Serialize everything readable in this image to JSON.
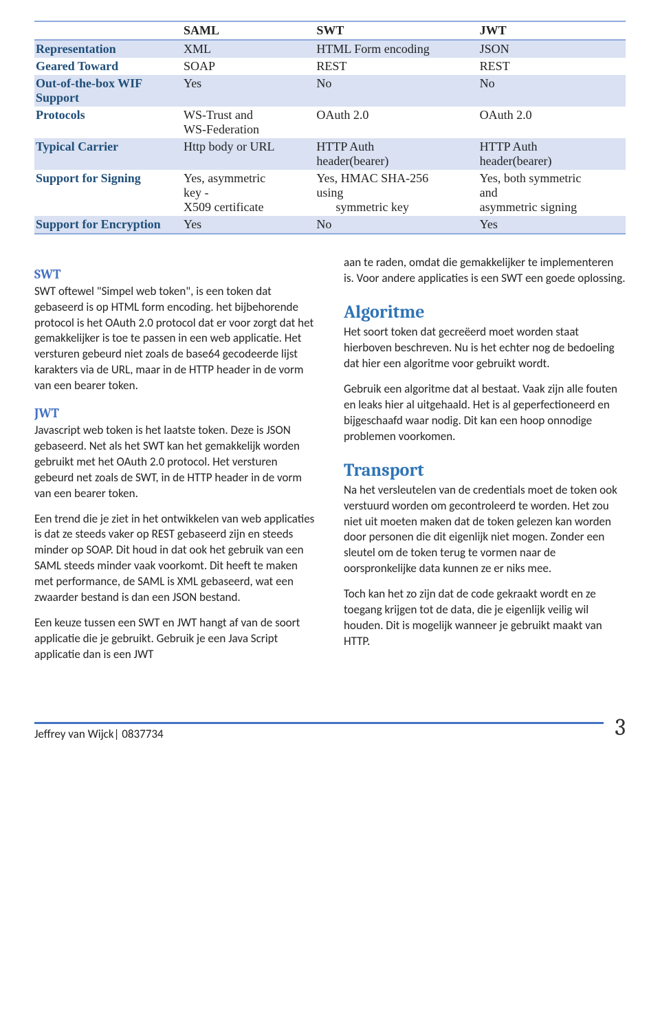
{
  "table": {
    "headers": [
      "",
      "SAML",
      "SWT",
      "JWT"
    ],
    "rows": [
      {
        "band": true,
        "label": "Representation",
        "saml": "XML",
        "swt": "HTML Form encoding",
        "jwt": "JSON"
      },
      {
        "band": false,
        "label": "Geared Toward",
        "saml": "SOAP",
        "swt": "REST",
        "jwt": "REST"
      },
      {
        "band": true,
        "label": "Out-of-the-box WIF\nSupport",
        "saml": "Yes",
        "swt": "No",
        "jwt": "No"
      },
      {
        "band": false,
        "label": "Protocols",
        "saml": "WS-Trust and\nWS-Federation",
        "swt": "OAuth 2.0",
        "jwt": "OAuth 2.0"
      },
      {
        "band": true,
        "label": "Typical Carrier",
        "saml": "Http body or URL",
        "swt": "HTTP Auth\nheader(bearer)",
        "jwt": "HTTP Auth\nheader(bearer)"
      },
      {
        "band": false,
        "label": "Support for Signing",
        "saml": "Yes, asymmetric\nkey -\nX509 certificate",
        "swt": "Yes, HMAC SHA-256\nusing",
        "swt_indent": "symmetric key",
        "jwt": "Yes, both symmetric\nand\nasymmetric signing"
      },
      {
        "band": true,
        "label": "Support for Encryption",
        "saml": "Yes",
        "swt": "No",
        "jwt": "Yes"
      }
    ]
  },
  "left": {
    "swt_heading": "SWT",
    "swt_para": "SWT oftewel \"Simpel web token\", is een token dat gebaseerd is op HTML form encoding. het bijbehorende protocol is het OAuth 2.0 protocol dat er voor zorgt dat het gemakkelijker is toe te passen in een web applicatie. Het versturen gebeurd niet zoals de base64 gecodeerde lijst karakters via de URL, maar in de HTTP header in de vorm van een bearer token.",
    "jwt_heading": "JWT",
    "jwt_para": "Javascript web token is het laatste token. Deze is JSON gebaseerd. Net als het SWT kan het gemakkelijk worden gebruikt met het OAuth 2.0 protocol. Het versturen gebeurd net zoals de SWT, in de HTTP header in de vorm van een bearer token.",
    "trend_para": "Een trend die je ziet in het ontwikkelen van web applicaties is dat ze steeds vaker op REST gebaseerd zijn en steeds minder op SOAP. Dit houd in dat ook het gebruik van een SAML steeds minder vaak voorkomt. Dit heeft te maken met performance, de SAML is XML gebaseerd, wat een zwaarder bestand is dan een JSON bestand.",
    "keuze_para": "Een keuze tussen een SWT en JWT hangt af van de soort applicatie die je gebruikt. Gebruik je een Java Script applicatie dan is een JWT"
  },
  "right": {
    "cont_para": "aan te raden, omdat die gemakkelijker te implementeren is. Voor andere applicaties is een SWT een goede oplossing.",
    "algoritme_heading": "Algoritme",
    "algoritme_para1": "Het soort token dat gecreëerd moet worden staat hierboven beschreven. Nu is het echter nog de bedoeling dat hier een algoritme voor gebruikt wordt.",
    "algoritme_para2": "Gebruik een algoritme dat al bestaat. Vaak zijn alle fouten en leaks hier al uitgehaald. Het is al geperfectioneerd en bijgeschaafd waar nodig. Dit kan een hoop onnodige problemen voorkomen.",
    "transport_heading": "Transport",
    "transport_para1": "Na het versleutelen van de credentials moet de token ook verstuurd worden om gecontroleerd te worden. Het zou niet uit moeten maken dat de token gelezen kan worden door personen die dit eigenlijk niet mogen. Zonder een sleutel om de token terug te vormen naar de oorspronkelijke data kunnen ze er niks mee.",
    "transport_para2": "Toch kan het zo zijn dat de code gekraakt wordt en ze toegang krijgen tot de data, die je eigenlijk veilig wil houden. Dit is mogelijk wanneer je gebruikt maakt van HTTP."
  },
  "footer": {
    "author": "Jeffrey van Wijck| 0837734",
    "page": "3"
  }
}
